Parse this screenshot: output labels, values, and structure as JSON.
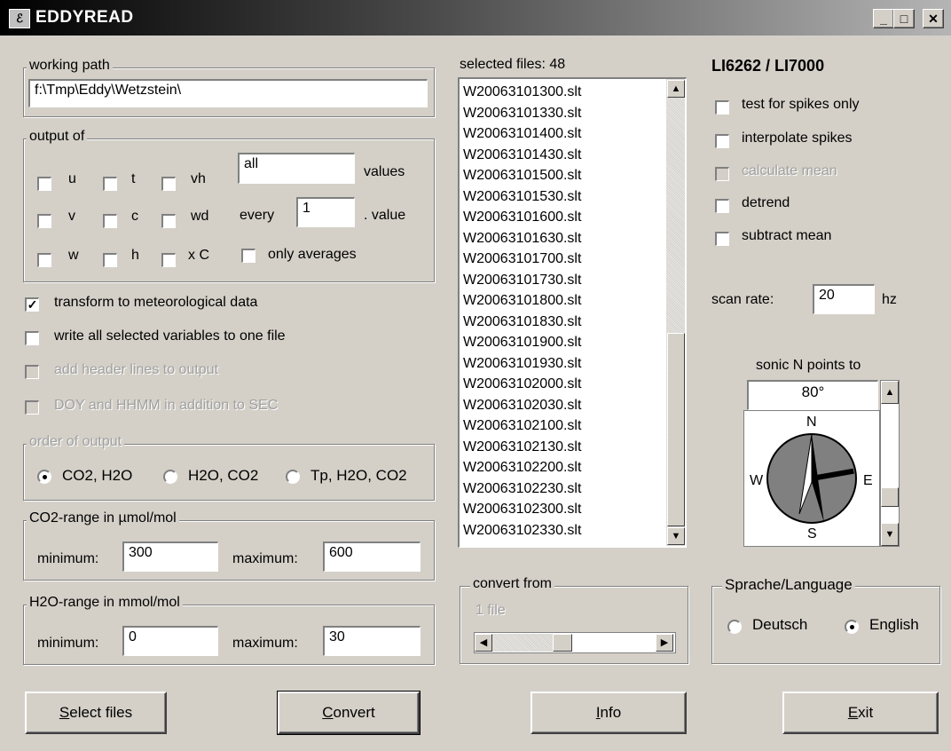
{
  "window": {
    "title": "EDDYREAD",
    "icon": "app-icon",
    "min_glyph": "_",
    "max_glyph": "□",
    "close_glyph": "✕"
  },
  "working_path": {
    "legend": "working path",
    "value": "f:\\Tmp\\Eddy\\Wetzstein\\"
  },
  "output_of": {
    "legend": "output of",
    "vars": [
      "u",
      "t",
      "vh",
      "v",
      "c",
      "wd",
      "w",
      "h",
      "x C"
    ],
    "values_input": "all",
    "values_label": "values",
    "every_label": "every",
    "every_input": "1",
    "value_label": ". value",
    "only_averages": "only averages"
  },
  "options": {
    "transform": "transform to meteorological data",
    "write_all": "write all selected variables to one file",
    "header_lines": "add header lines to output",
    "doy": "DOY and HHMM in addition to SEC"
  },
  "order": {
    "legend": "order of output",
    "opt1": "CO2, H2O",
    "opt2": "H2O, CO2",
    "opt3": "Tp, H2O, CO2"
  },
  "co2": {
    "legend": "CO2-range in µmol/mol",
    "min_label": "minimum:",
    "min": "300",
    "max_label": "maximum:",
    "max": "600"
  },
  "h2o": {
    "legend": "H2O-range in mmol/mol",
    "min_label": "minimum:",
    "min": "0",
    "max_label": "maximum:",
    "max": "30"
  },
  "files": {
    "header": "selected files: 48",
    "items": [
      "W20063101300.slt",
      "W20063101330.slt",
      "W20063101400.slt",
      "W20063101430.slt",
      "W20063101500.slt",
      "W20063101530.slt",
      "W20063101600.slt",
      "W20063101630.slt",
      "W20063101700.slt",
      "W20063101730.slt",
      "W20063101800.slt",
      "W20063101830.slt",
      "W20063101900.slt",
      "W20063101930.slt",
      "W20063102000.slt",
      "W20063102030.slt",
      "W20063102100.slt",
      "W20063102130.slt",
      "W20063102200.slt",
      "W20063102230.slt",
      "W20063102300.slt",
      "W20063102330.slt"
    ]
  },
  "convert_from": {
    "legend": "convert from",
    "value": "1 file"
  },
  "analyzer": {
    "title": "LI6262 / LI7000",
    "spikes_only": "test for spikes only",
    "interpolate": "interpolate spikes",
    "mean": "calculate mean",
    "detrend": "detrend",
    "subtract": "subtract mean",
    "scan_label": "scan rate:",
    "scan_value": "20",
    "scan_unit": "hz"
  },
  "sonic": {
    "label": "sonic N points to",
    "value": "80°",
    "n": "N",
    "e": "E",
    "s": "S",
    "w": "W",
    "heading_deg": 80
  },
  "language": {
    "legend": "Sprache/Language",
    "de": "Deutsch",
    "en": "English"
  },
  "buttons": {
    "select_u": "S",
    "select_rest": "elect files",
    "convert_u": "C",
    "convert_rest": "onvert",
    "info_u": "I",
    "info_rest": "nfo",
    "exit_u": "E",
    "exit_rest": "xit"
  }
}
